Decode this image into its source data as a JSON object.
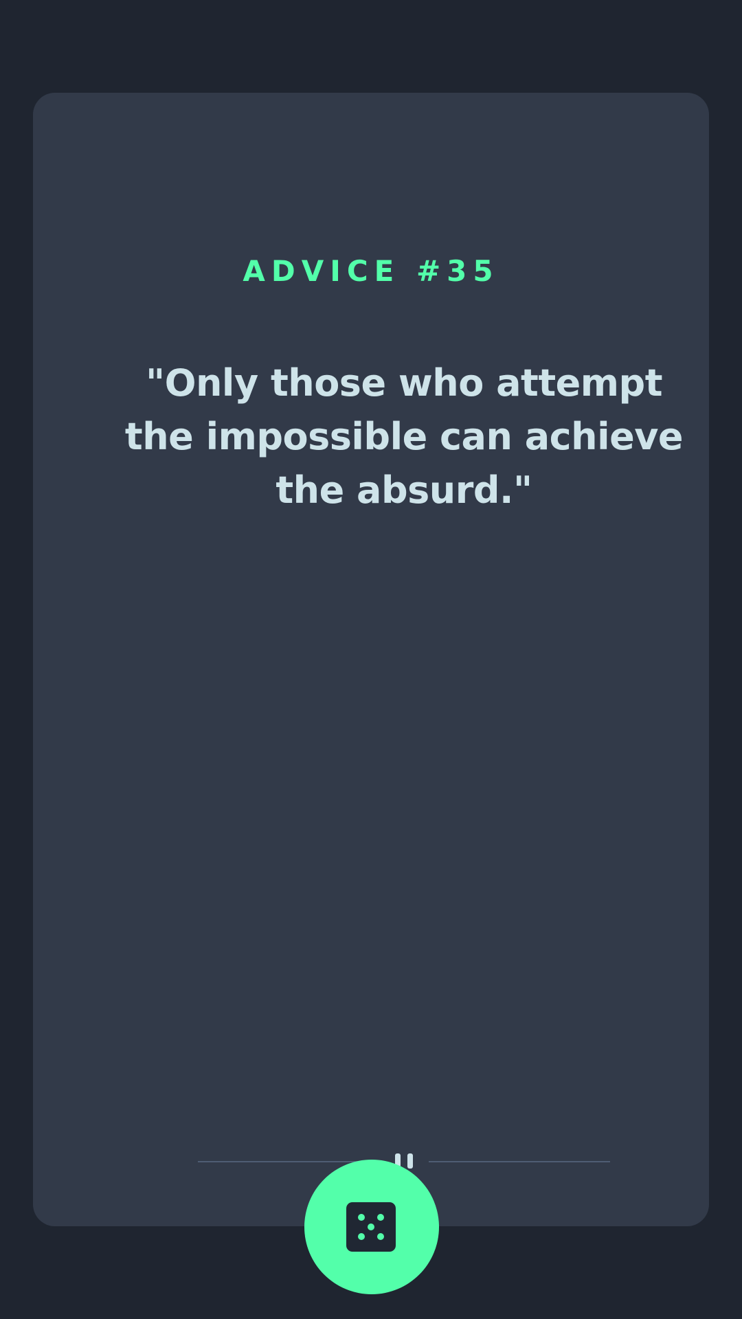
{
  "card": {
    "advice_label": "ADVICE #35",
    "quote": "\"Only those who attempt the impossible can achieve the absurd.\""
  },
  "divider": {
    "icon": "pause-icon"
  },
  "dice_button": {
    "icon": "dice-icon"
  },
  "colors": {
    "background": "#1f2530",
    "card": "#323a49",
    "accent": "#53ffaa",
    "text": "#cee3e9",
    "divider_line": "#4f5d74"
  }
}
